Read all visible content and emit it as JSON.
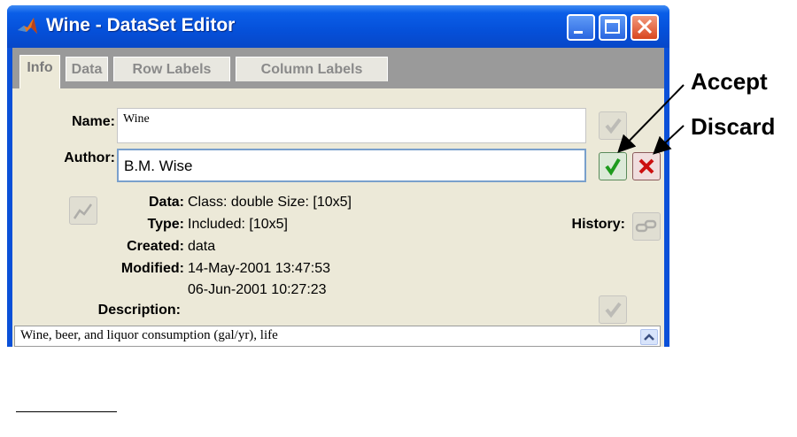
{
  "window": {
    "title": "Wine - DataSet Editor",
    "controls": [
      "minimize",
      "maximize",
      "close"
    ]
  },
  "tabs": [
    {
      "label": "Info",
      "active": true
    },
    {
      "label": "Data",
      "active": false
    },
    {
      "label": "Row Labels",
      "active": false
    },
    {
      "label": "Column Labels",
      "active": false
    }
  ],
  "form": {
    "name_label": "Name:",
    "name_value": "Wine",
    "author_label": "Author:",
    "author_value": "B.M. Wise"
  },
  "info": {
    "data_label": "Data:",
    "data_value": "Class: double  Size: [10x5]",
    "type_label": "Type:",
    "type_value": "Included: [10x5]",
    "created_label": "Created:",
    "created_value": "data",
    "modified_label": "Modified:",
    "modified_value_1": "14-May-2001 13:47:53",
    "modified_value_2": "06-Jun-2001 10:27:23",
    "history_label": "History:",
    "description_label": "Description:",
    "description_text": "Wine, beer, and liquor consumption (gal/yr), life"
  },
  "annotations": {
    "accept": "Accept",
    "discard": "Discard"
  },
  "colors": {
    "titlebar": "#0550d9",
    "client_bg": "#ece9d8",
    "accept_check": "#1e9b1e",
    "discard_x": "#cc1010"
  }
}
